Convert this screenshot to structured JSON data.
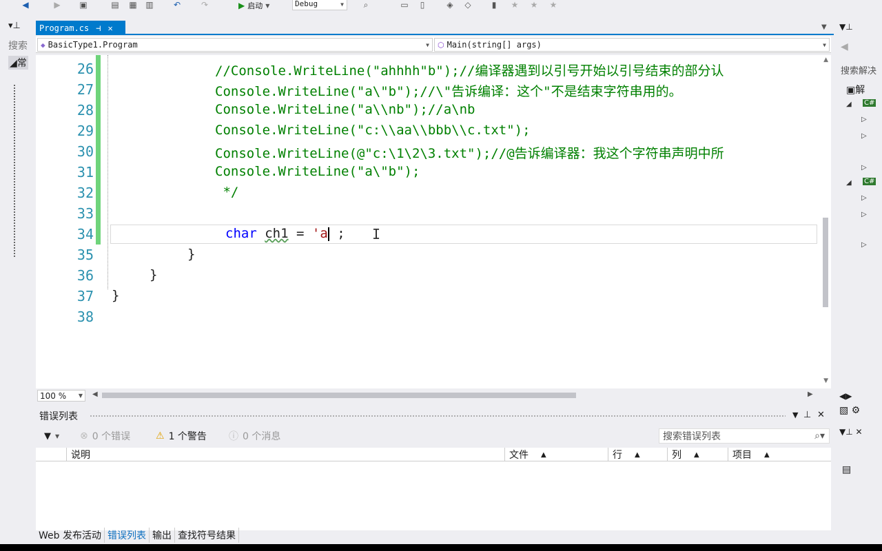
{
  "toolbar": {
    "start_label": "启动",
    "config": "Debug"
  },
  "editor": {
    "tab_title": "Program.cs",
    "nav_class": "BasicType1.Program",
    "nav_member": "Main(string[] args)",
    "zoom": "100 %",
    "lines": [
      {
        "num": "26",
        "text": "//Console.WriteLine(\"ahhhh\"b\");//编译器遇到以引号开始以引号结束的部分认"
      },
      {
        "num": "27",
        "text": "Console.WriteLine(\"a\\\"b\");//\\\"告诉编译：这个\"不是结束字符串用的。"
      },
      {
        "num": "28",
        "text": "Console.WriteLine(\"a\\\\nb\");//a\\nb"
      },
      {
        "num": "29",
        "text": "Console.WriteLine(\"c:\\\\aa\\\\bbb\\\\c.txt\");"
      },
      {
        "num": "30",
        "text": "Console.WriteLine(@\"c:\\1\\2\\3.txt\");//@告诉编译器：我这个字符串声明中所"
      },
      {
        "num": "31",
        "text": "Console.WriteLine(\"a\\\"b\");"
      },
      {
        "num": "32",
        "text": " */"
      },
      {
        "num": "33",
        "text": ""
      },
      {
        "num": "34",
        "text": ""
      },
      {
        "num": "35",
        "text": "}"
      },
      {
        "num": "36",
        "text": "}"
      },
      {
        "num": "37",
        "text": "}"
      },
      {
        "num": "38",
        "text": ""
      }
    ],
    "line34": {
      "kw": "char",
      "ident": "ch1",
      "op": " = ",
      "str": "'a",
      "tail": " ;"
    }
  },
  "error_list": {
    "title": "错误列表",
    "errors": "0 个错误",
    "warnings": "1 个警告",
    "messages": "0 个消息",
    "search_placeholder": "搜索错误列表",
    "columns": [
      "说明",
      "文件",
      "行",
      "列",
      "项目"
    ]
  },
  "bottom_tabs": [
    "Web 发布活动",
    "错误列表",
    "输出",
    "查找符号结果"
  ],
  "left_panel": {
    "search": "搜索",
    "common": "常"
  },
  "right_panel": {
    "search": "搜索解决",
    "solution": "解"
  },
  "colors": {
    "accent": "#007acc",
    "keyword": "#0000ff",
    "comment": "#008000",
    "linenum": "#2b91af",
    "string": "#a31515"
  }
}
